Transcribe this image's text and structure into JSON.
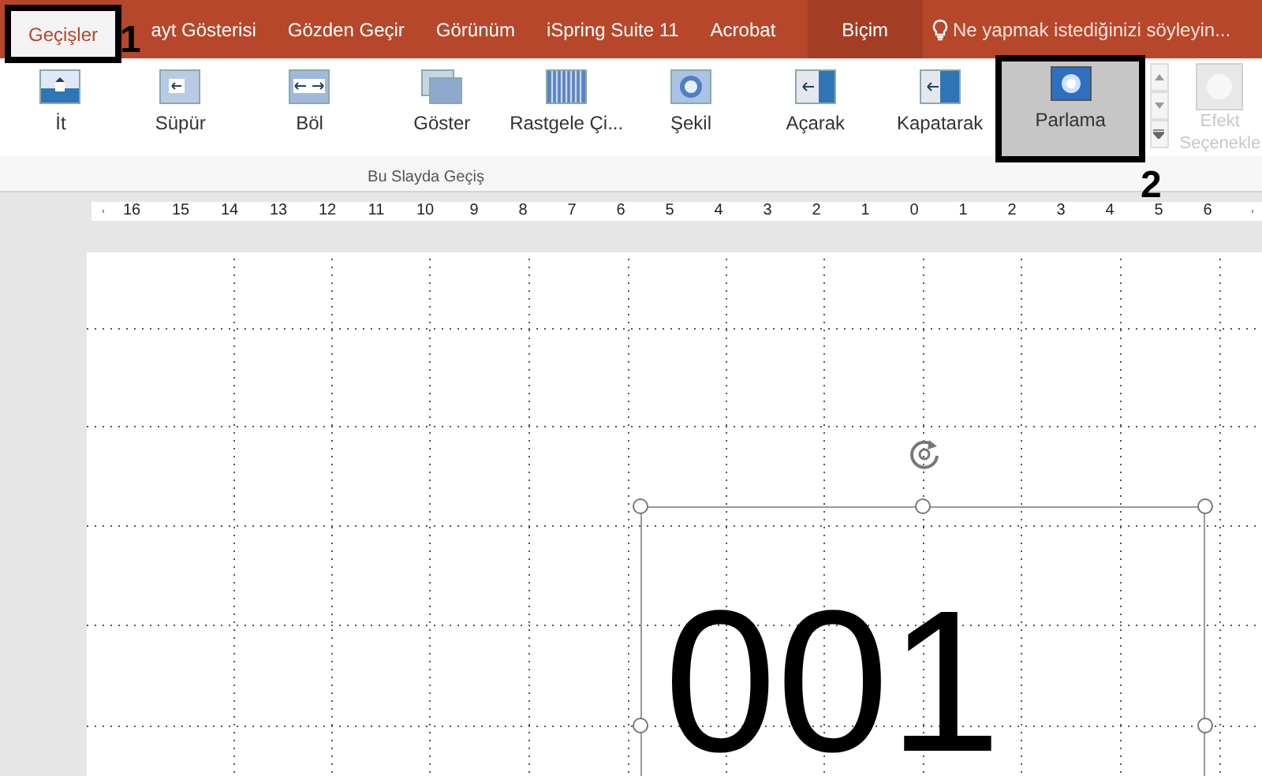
{
  "tabs": [
    {
      "label": "Geçişler",
      "selected": true,
      "kind": "tab",
      "callout": "1"
    },
    {
      "label": "ayt Gösterisi",
      "selected": false,
      "kind": "tab"
    },
    {
      "label": "Gözden Geçir",
      "selected": false,
      "kind": "tab"
    },
    {
      "label": "Görünüm",
      "selected": false,
      "kind": "tab"
    },
    {
      "label": "iSpring Suite 11",
      "selected": false,
      "kind": "tab"
    },
    {
      "label": "Acrobat",
      "selected": false,
      "kind": "tab"
    },
    {
      "label": "Biçim",
      "selected": false,
      "kind": "contextual"
    }
  ],
  "tell_me": {
    "placeholder": "Ne yapmak istediğinizi söyleyin..."
  },
  "ribbon": {
    "transitions": [
      {
        "label": "İt",
        "selected": false
      },
      {
        "label": "Süpür",
        "selected": false
      },
      {
        "label": "Böl",
        "selected": false
      },
      {
        "label": "Göster",
        "selected": false
      },
      {
        "label": "Rastgele Çi...",
        "selected": false
      },
      {
        "label": "Şekil",
        "selected": false
      },
      {
        "label": "Açarak",
        "selected": false
      },
      {
        "label": "Kapatarak",
        "selected": false
      },
      {
        "label": "Parlama",
        "selected": true,
        "callout": "2"
      }
    ],
    "effect_options": {
      "lines": [
        "Efekt",
        "Seçenekle"
      ],
      "disabled": true
    },
    "group_label": "Bu Slayda Geçiş"
  },
  "ruler": {
    "labels": [
      "16",
      "15",
      "14",
      "13",
      "12",
      "11",
      "10",
      "9",
      "8",
      "7",
      "6",
      "5",
      "4",
      "3",
      "2",
      "1",
      "0",
      "1",
      "2",
      "3",
      "4",
      "5",
      "6"
    ]
  },
  "slide": {
    "text": "001",
    "selected": true
  }
}
